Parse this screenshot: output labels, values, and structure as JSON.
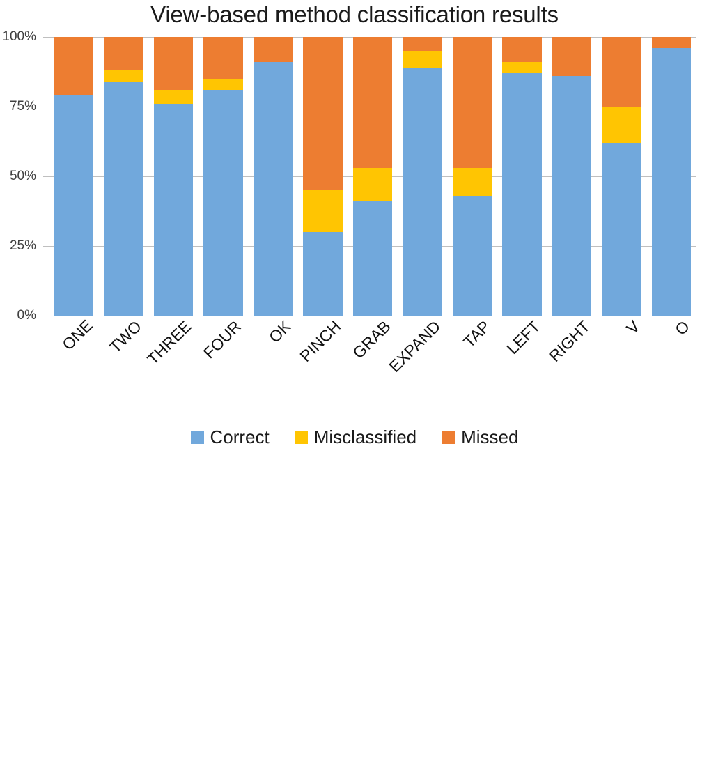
{
  "chart_data": {
    "type": "bar",
    "subtype": "stacked-bar-100-percent",
    "title": "View-based method classification results",
    "xlabel": "",
    "ylabel": "",
    "ylim": [
      0,
      100
    ],
    "yticks": [
      0,
      25,
      50,
      75,
      100
    ],
    "ytick_labels": [
      "0%",
      "25%",
      "50%",
      "75%",
      "100%"
    ],
    "grid": true,
    "grid_axis": "y",
    "legend_position": "bottom",
    "categories": [
      "ONE",
      "TWO",
      "THREE",
      "FOUR",
      "OK",
      "PINCH",
      "GRAB",
      "EXPAND",
      "TAP",
      "LEFT",
      "RIGHT",
      "V",
      "O"
    ],
    "series": [
      {
        "name": "Correct",
        "color": "#71a8dc",
        "values": [
          79,
          84,
          76,
          81,
          91,
          30,
          41,
          89,
          43,
          87,
          86,
          62,
          96
        ]
      },
      {
        "name": "Misclassified",
        "color": "#ffc502",
        "values": [
          0,
          4,
          5,
          4,
          0,
          15,
          12,
          6,
          10,
          4,
          0,
          13,
          0
        ]
      },
      {
        "name": "Missed",
        "color": "#ed7d31",
        "values": [
          21,
          12,
          19,
          15,
          9,
          55,
          47,
          5,
          47,
          9,
          14,
          25,
          4
        ]
      }
    ]
  }
}
